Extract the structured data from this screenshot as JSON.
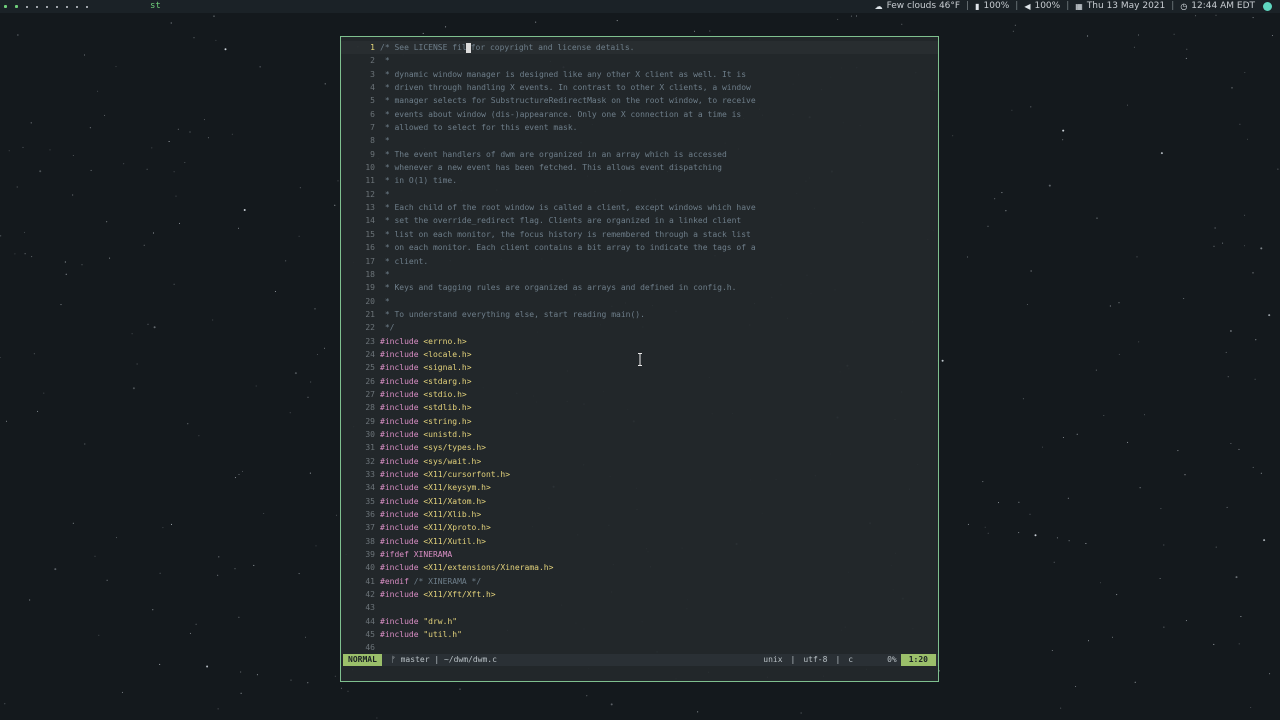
{
  "topbar": {
    "layout_label": "st",
    "weather": "Few clouds 46°F",
    "battery": "100%",
    "volume": "100%",
    "date": "Thu 13 May 2021",
    "time": "12:44 AM EDT"
  },
  "editor": {
    "lines": [
      {
        "n": "1",
        "segments": [
          {
            "t": "cm",
            "v": "/* See LICENSE fil"
          },
          {
            "t": "cursor",
            "v": ""
          },
          {
            "t": "cm",
            "v": "for copyright and license details."
          }
        ]
      },
      {
        "n": "2",
        "segments": [
          {
            "t": "cm",
            "v": " *"
          }
        ]
      },
      {
        "n": "3",
        "segments": [
          {
            "t": "cm",
            "v": " * dynamic window manager is designed like any other X client as well. It is"
          }
        ]
      },
      {
        "n": "4",
        "segments": [
          {
            "t": "cm",
            "v": " * driven through handling X events. In contrast to other X clients, a window"
          }
        ]
      },
      {
        "n": "5",
        "segments": [
          {
            "t": "cm",
            "v": " * manager selects for SubstructureRedirectMask on the root window, to receive"
          }
        ]
      },
      {
        "n": "6",
        "segments": [
          {
            "t": "cm",
            "v": " * events about window (dis-)appearance. Only one X connection at a time is"
          }
        ]
      },
      {
        "n": "7",
        "segments": [
          {
            "t": "cm",
            "v": " * allowed to select for this event mask."
          }
        ]
      },
      {
        "n": "8",
        "segments": [
          {
            "t": "cm",
            "v": " *"
          }
        ]
      },
      {
        "n": "9",
        "segments": [
          {
            "t": "cm",
            "v": " * The event handlers of dwm are organized in an array which is accessed"
          }
        ]
      },
      {
        "n": "10",
        "segments": [
          {
            "t": "cm",
            "v": " * whenever a new event has been fetched. This allows event dispatching"
          }
        ]
      },
      {
        "n": "11",
        "segments": [
          {
            "t": "cm",
            "v": " * in O(1) time."
          }
        ]
      },
      {
        "n": "12",
        "segments": [
          {
            "t": "cm",
            "v": " *"
          }
        ]
      },
      {
        "n": "13",
        "segments": [
          {
            "t": "cm",
            "v": " * Each child of the root window is called a client, except windows which have"
          }
        ]
      },
      {
        "n": "14",
        "segments": [
          {
            "t": "cm",
            "v": " * set the override_redirect flag. Clients are organized in a linked client"
          }
        ]
      },
      {
        "n": "15",
        "segments": [
          {
            "t": "cm",
            "v": " * list on each monitor, the focus history is remembered through a stack list"
          }
        ]
      },
      {
        "n": "16",
        "segments": [
          {
            "t": "cm",
            "v": " * on each monitor. Each client contains a bit array to indicate the tags of a"
          }
        ]
      },
      {
        "n": "17",
        "segments": [
          {
            "t": "cm",
            "v": " * client."
          }
        ]
      },
      {
        "n": "18",
        "segments": [
          {
            "t": "cm",
            "v": " *"
          }
        ]
      },
      {
        "n": "19",
        "segments": [
          {
            "t": "cm",
            "v": " * Keys and tagging rules are organized as arrays and defined in config.h."
          }
        ]
      },
      {
        "n": "20",
        "segments": [
          {
            "t": "cm",
            "v": " *"
          }
        ]
      },
      {
        "n": "21",
        "segments": [
          {
            "t": "cm",
            "v": " * To understand everything else, start reading main()."
          }
        ]
      },
      {
        "n": "22",
        "segments": [
          {
            "t": "cm",
            "v": " */"
          }
        ]
      },
      {
        "n": "23",
        "segments": [
          {
            "t": "pp",
            "v": "#include "
          },
          {
            "t": "hd",
            "v": "<errno.h>"
          }
        ]
      },
      {
        "n": "24",
        "segments": [
          {
            "t": "pp",
            "v": "#include "
          },
          {
            "t": "hd",
            "v": "<locale.h>"
          }
        ]
      },
      {
        "n": "25",
        "segments": [
          {
            "t": "pp",
            "v": "#include "
          },
          {
            "t": "hd",
            "v": "<signal.h>"
          }
        ]
      },
      {
        "n": "26",
        "segments": [
          {
            "t": "pp",
            "v": "#include "
          },
          {
            "t": "hd",
            "v": "<stdarg.h>"
          }
        ]
      },
      {
        "n": "27",
        "segments": [
          {
            "t": "pp",
            "v": "#include "
          },
          {
            "t": "hd",
            "v": "<stdio.h>"
          }
        ]
      },
      {
        "n": "28",
        "segments": [
          {
            "t": "pp",
            "v": "#include "
          },
          {
            "t": "hd",
            "v": "<stdlib.h>"
          }
        ]
      },
      {
        "n": "29",
        "segments": [
          {
            "t": "pp",
            "v": "#include "
          },
          {
            "t": "hd",
            "v": "<string.h>"
          }
        ]
      },
      {
        "n": "30",
        "segments": [
          {
            "t": "pp",
            "v": "#include "
          },
          {
            "t": "hd",
            "v": "<unistd.h>"
          }
        ]
      },
      {
        "n": "31",
        "segments": [
          {
            "t": "pp",
            "v": "#include "
          },
          {
            "t": "hd",
            "v": "<sys/types.h>"
          }
        ]
      },
      {
        "n": "32",
        "segments": [
          {
            "t": "pp",
            "v": "#include "
          },
          {
            "t": "hd",
            "v": "<sys/wait.h>"
          }
        ]
      },
      {
        "n": "33",
        "segments": [
          {
            "t": "pp",
            "v": "#include "
          },
          {
            "t": "hd",
            "v": "<X11/cursorfont.h>"
          }
        ]
      },
      {
        "n": "34",
        "segments": [
          {
            "t": "pp",
            "v": "#include "
          },
          {
            "t": "hd",
            "v": "<X11/keysym.h>"
          }
        ]
      },
      {
        "n": "35",
        "segments": [
          {
            "t": "pp",
            "v": "#include "
          },
          {
            "t": "hd",
            "v": "<X11/Xatom.h>"
          }
        ]
      },
      {
        "n": "36",
        "segments": [
          {
            "t": "pp",
            "v": "#include "
          },
          {
            "t": "hd",
            "v": "<X11/Xlib.h>"
          }
        ]
      },
      {
        "n": "37",
        "segments": [
          {
            "t": "pp",
            "v": "#include "
          },
          {
            "t": "hd",
            "v": "<X11/Xproto.h>"
          }
        ]
      },
      {
        "n": "38",
        "segments": [
          {
            "t": "pp",
            "v": "#include "
          },
          {
            "t": "hd",
            "v": "<X11/Xutil.h>"
          }
        ]
      },
      {
        "n": "39",
        "segments": [
          {
            "t": "pp",
            "v": "#ifdef XINERAMA"
          }
        ]
      },
      {
        "n": "40",
        "segments": [
          {
            "t": "pp",
            "v": "#include "
          },
          {
            "t": "hd",
            "v": "<X11/extensions/Xinerama.h>"
          }
        ]
      },
      {
        "n": "41",
        "segments": [
          {
            "t": "pp",
            "v": "#endif "
          },
          {
            "t": "cm",
            "v": "/* XINERAMA */"
          }
        ]
      },
      {
        "n": "42",
        "segments": [
          {
            "t": "pp",
            "v": "#include "
          },
          {
            "t": "hd",
            "v": "<X11/Xft/Xft.h>"
          }
        ]
      },
      {
        "n": "43",
        "segments": []
      },
      {
        "n": "44",
        "segments": [
          {
            "t": "pp",
            "v": "#include "
          },
          {
            "t": "hd",
            "v": "\"drw.h\""
          }
        ]
      },
      {
        "n": "45",
        "segments": [
          {
            "t": "pp",
            "v": "#include "
          },
          {
            "t": "hd",
            "v": "\"util.h\""
          }
        ]
      },
      {
        "n": "46",
        "segments": []
      }
    ]
  },
  "statusline": {
    "mode": "NORMAL",
    "branch": "ᚠ master | ~/dwm/dwm.c",
    "fileformat": "unix",
    "encoding": "utf-8",
    "filetype": "c",
    "percent": "0%",
    "position": "1:20"
  },
  "colors": {
    "accent": "#9bbf6a",
    "border": "#7fc08f",
    "comment": "#6e7e8a",
    "preproc": "#d98ec4",
    "header": "#e3d27b"
  }
}
